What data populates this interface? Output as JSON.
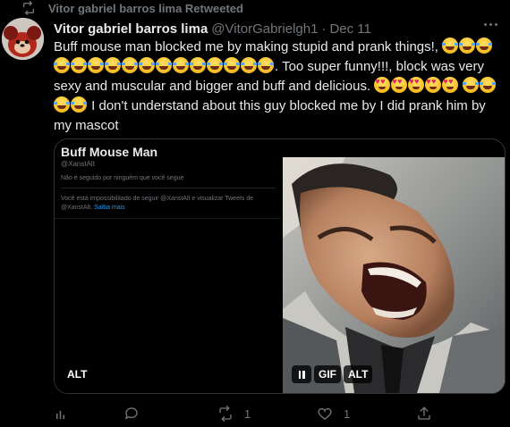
{
  "retweet_banner": {
    "text": "Vitor gabriel barros lima Retweeted",
    "icon": "retweet-icon"
  },
  "tweet": {
    "author_name": "Vitor gabriel barros lima",
    "author_handle": "@VitorGabrielgh1",
    "separator": "·",
    "date": "Dec 11",
    "text_part1": "Buff mouse man blocked me by making stupid and prank things!, ",
    "text_part2": ". Too super funny!!!, block was very sexy and muscular and bigger and buff and delicious. ",
    "text_part3": " I don't understand about this guy blocked me by I did prank him by my mascot",
    "emoji_run1": "😂😂😂😂😂😂😂😂😂😂😂😂😂😂😂😂",
    "emoji_run2": "😍😍😍😍😍",
    "emoji_run3": "😂😂😂😂"
  },
  "screenshot": {
    "title": "Buff Mouse Man",
    "handle": "@XanstAlt",
    "follow_status": "Não é seguido por ninguém que você segue",
    "blocked_text": "Você está impossibilitado de seguir @XanstAlt e visualizar Tweets de @XanstAlt.",
    "learn_more": "Saiba mais",
    "alt_badge": "ALT"
  },
  "gif": {
    "gif_badge": "GIF",
    "alt_badge": "ALT",
    "pause_label": "pause-icon"
  },
  "actions": {
    "views_icon": "analytics-icon",
    "reply_icon": "reply-icon",
    "retweet_icon": "retweet-icon",
    "retweet_count": "1",
    "like_icon": "heart-icon",
    "like_count": "1",
    "share_icon": "share-icon"
  },
  "colors": {
    "background": "#000000",
    "text_primary": "#e7e9ea",
    "text_secondary": "#71767b",
    "link": "#1d9bf0",
    "border": "#2f3336"
  }
}
